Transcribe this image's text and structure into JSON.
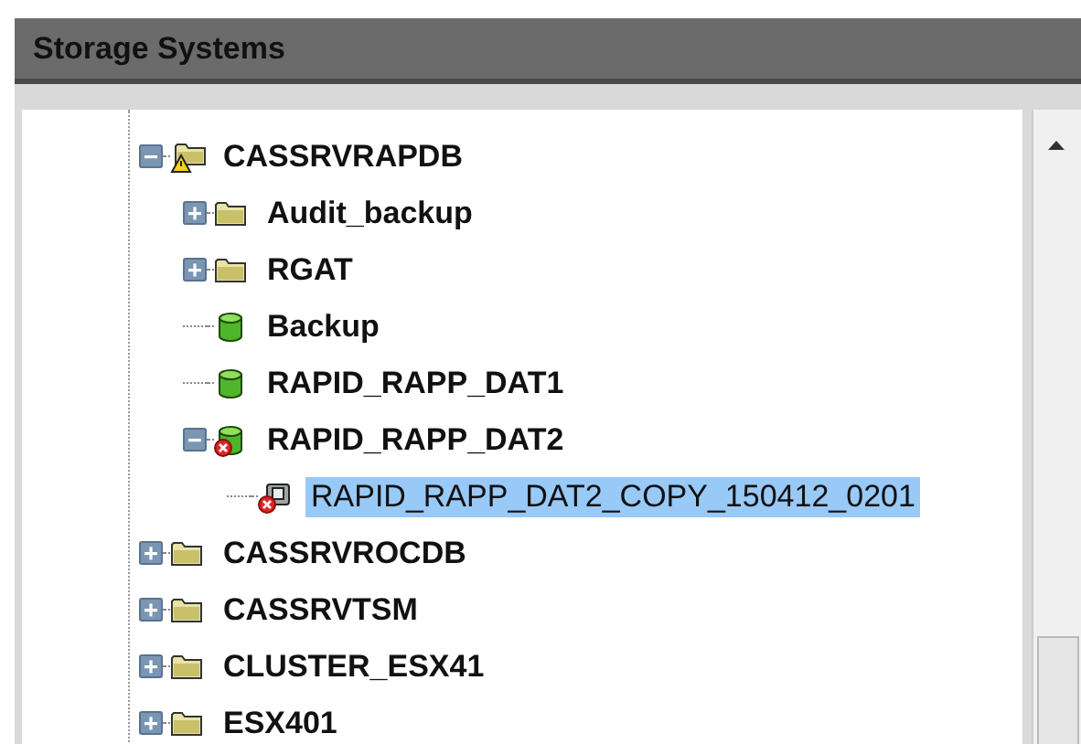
{
  "panel": {
    "title": "Storage Systems"
  },
  "tree": [
    {
      "label": "CASSRVRAPDB",
      "kind": "server-warning",
      "expanded": true,
      "selected": false,
      "children": [
        {
          "label": "Audit_backup",
          "kind": "folder",
          "expanded": false,
          "selected": false
        },
        {
          "label": "RGAT",
          "kind": "folder",
          "expanded": false,
          "selected": false
        },
        {
          "label": "Backup",
          "kind": "volume",
          "selected": false
        },
        {
          "label": "RAPID_RAPP_DAT1",
          "kind": "volume",
          "selected": false
        },
        {
          "label": "RAPID_RAPP_DAT2",
          "kind": "volume-error",
          "expanded": true,
          "selected": false,
          "children": [
            {
              "label": "RAPID_RAPP_DAT2_COPY_150412_0201",
              "kind": "snapshot-error",
              "selected": true
            }
          ]
        }
      ]
    },
    {
      "label": "CASSRVROCDB",
      "kind": "folder",
      "expanded": false,
      "selected": false
    },
    {
      "label": "CASSRVTSM",
      "kind": "folder",
      "expanded": false,
      "selected": false
    },
    {
      "label": "CLUSTER_ESX41",
      "kind": "folder",
      "expanded": false,
      "selected": false
    },
    {
      "label": "ESX401",
      "kind": "folder",
      "expanded": false,
      "selected": false
    }
  ]
}
